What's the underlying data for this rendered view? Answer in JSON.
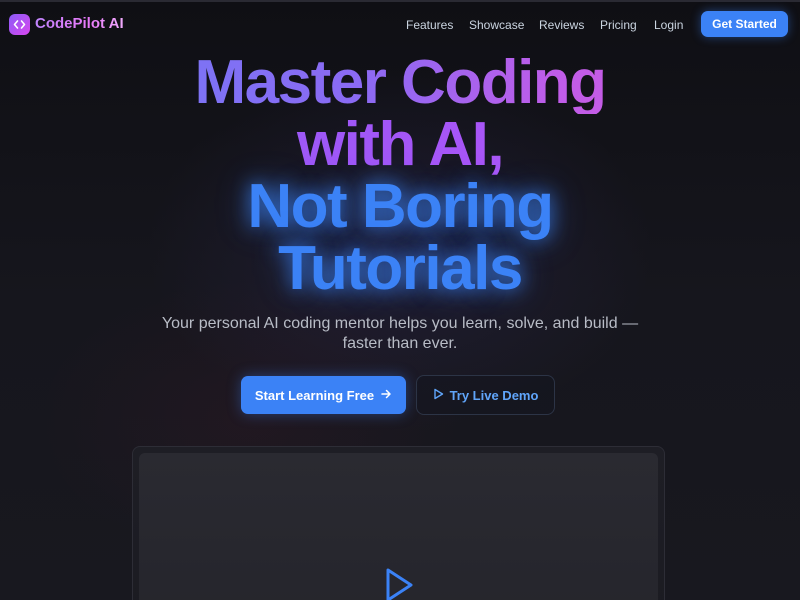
{
  "brand": {
    "name": "CodePilot AI",
    "logo_icon": "code-brackets-icon",
    "accent": "#3b82f6",
    "logo_gradient": [
      "#8b5cf6",
      "#d946ef"
    ]
  },
  "nav": {
    "links": [
      "Features",
      "Showcase",
      "Reviews",
      "Pricing",
      "Login"
    ],
    "cta": "Get Started"
  },
  "hero": {
    "line1": "Master Coding",
    "line2": "with AI,",
    "line3": "Not Boring",
    "line4": "Tutorials",
    "subtitle": "Your personal AI coding mentor helps you learn, solve, and build — faster than ever.",
    "primary_cta": "Start Learning Free",
    "primary_icon": "arrow-right-icon",
    "secondary_cta": "Try Live Demo",
    "secondary_icon": "play-icon"
  },
  "demo": {
    "play_icon": "play-icon"
  }
}
